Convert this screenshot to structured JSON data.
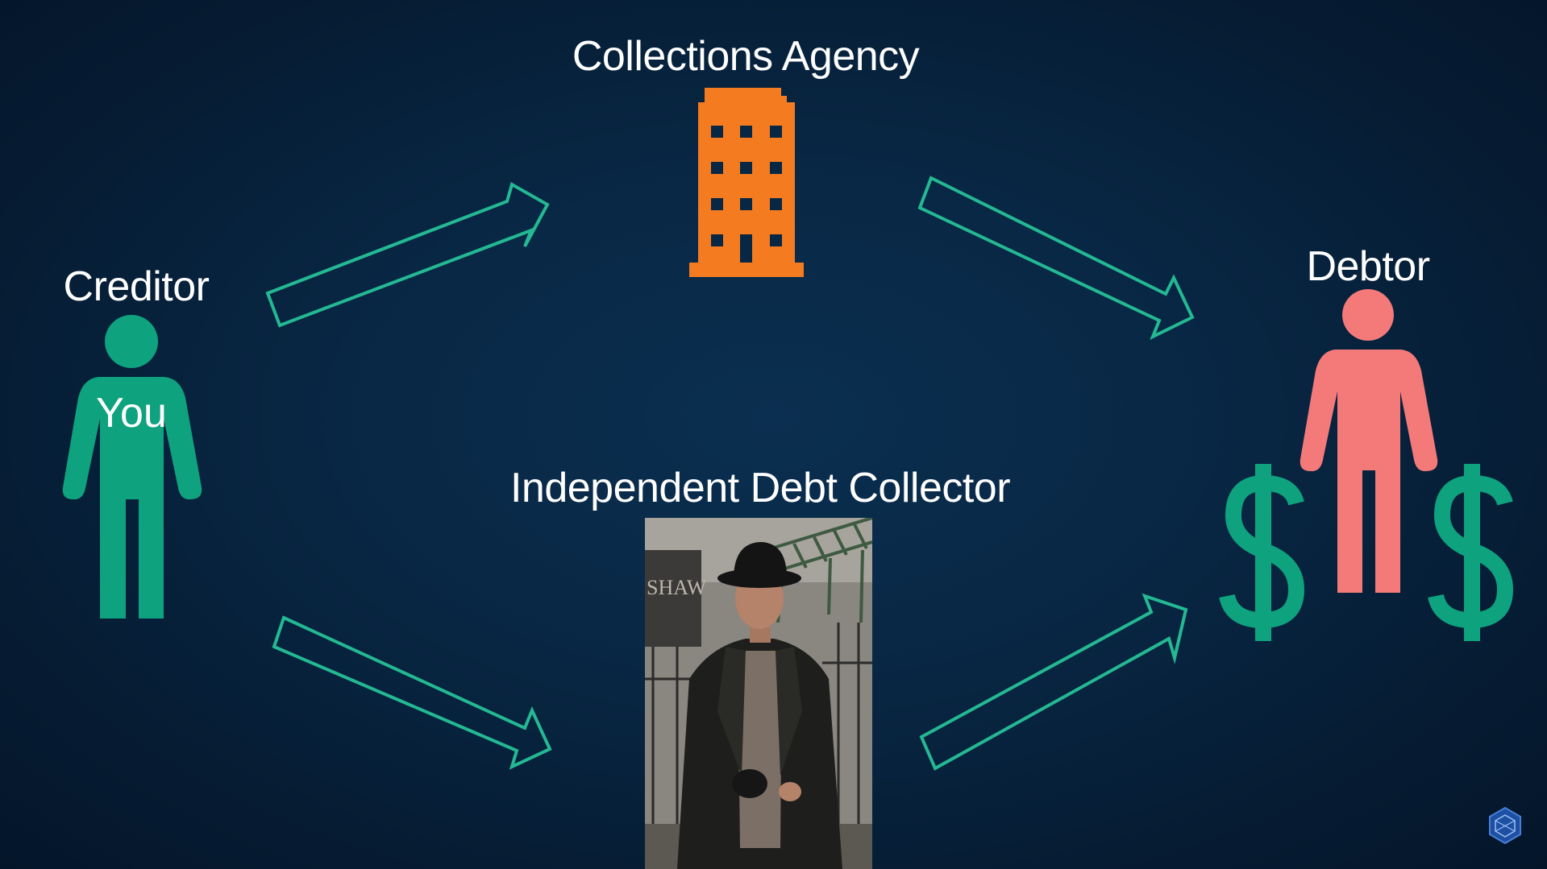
{
  "diagram": {
    "creditor": {
      "title": "Creditor",
      "inner_label": "You",
      "color": "#0ea27e"
    },
    "agency": {
      "title": "Collections Agency",
      "icon": "office-building-icon",
      "color": "#f47b20"
    },
    "collector": {
      "title": "Independent Debt Collector",
      "image": "person-in-leather-coat-photo"
    },
    "debtor": {
      "title": "Debtor",
      "color": "#f47a7a",
      "money_icon": "dollar-sign-icon",
      "money_color": "#0ea27e"
    },
    "arrow_color": "#24b893",
    "logo": "hexagon-logo-icon"
  }
}
